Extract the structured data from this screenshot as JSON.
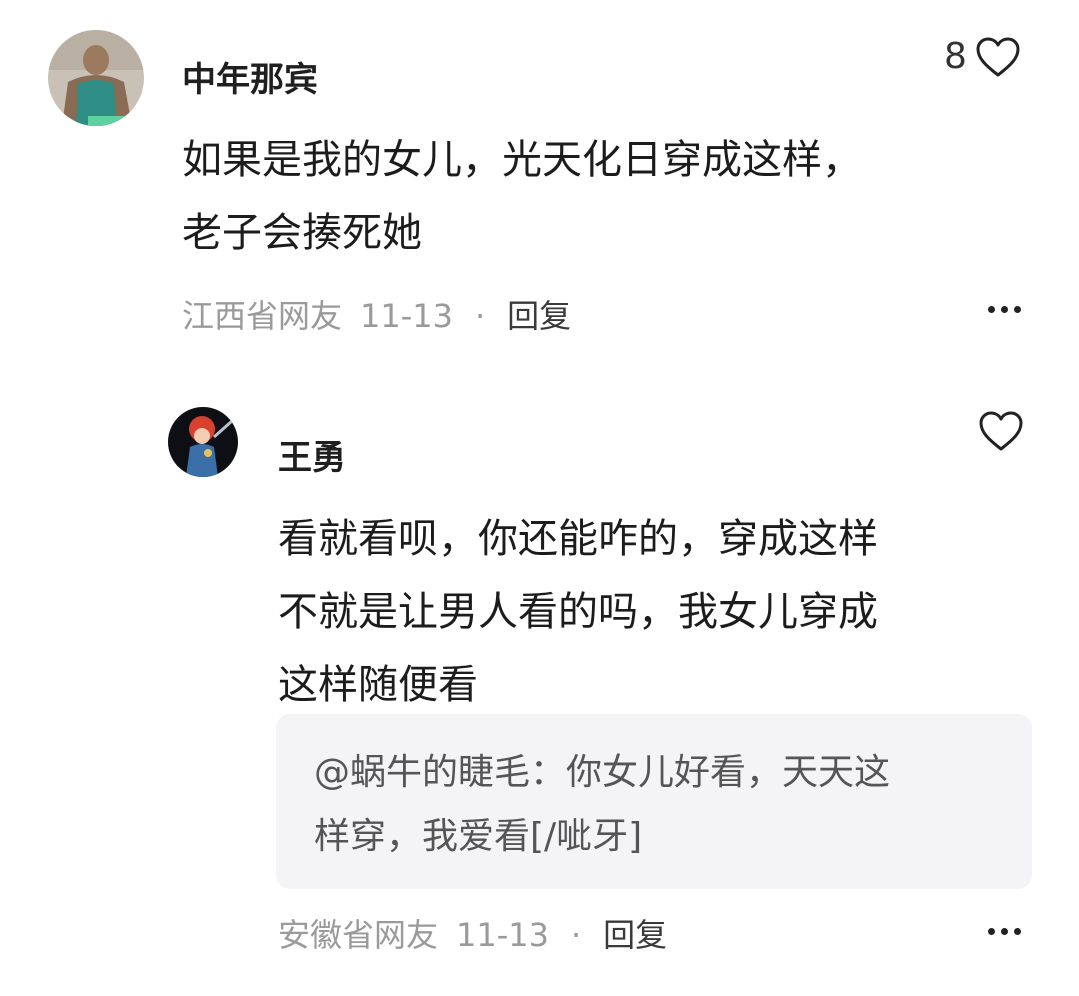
{
  "comment": {
    "username": "中年那宾",
    "likes": "8",
    "text_lines": [
      "如果是我的女儿，光天化日穿成这样，",
      "老子会揍死她"
    ],
    "location": "江西省网友",
    "date": "11-13",
    "dot": "·",
    "reply_label": "回复"
  },
  "reply": {
    "username": "王勇",
    "text_lines": [
      "看就看呗，你还能咋的，穿成这样",
      "不就是让男人看的吗，我女儿穿成",
      "这样随便看"
    ],
    "quote_lines": [
      "@蜗牛的睫毛：你女儿好看，天天这",
      "样穿，我爱看[/呲牙]"
    ],
    "location": "安徽省网友",
    "date": "11-13",
    "dot": "·",
    "reply_label": "回复"
  }
}
